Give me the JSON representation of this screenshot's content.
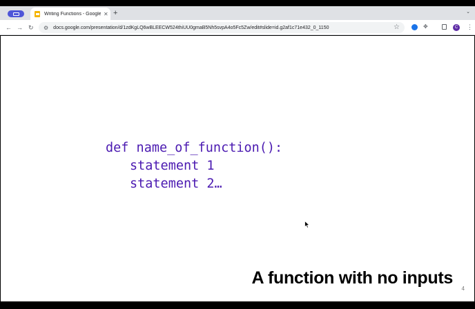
{
  "browser": {
    "tab": {
      "title": "Writing Functions - Google Slides",
      "close_glyph": "✕"
    },
    "new_tab_glyph": "+",
    "tab_search_glyph": "⌄",
    "nav": {
      "back": "←",
      "forward": "→",
      "reload": "↻"
    },
    "url": "docs.google.com/presentation/d/1zdKgLQ6wBLEECW524thiUU0gmaB5Nh5svpA4o5Fc5Zw/edit#slide=id.g2af1c71e432_0_1150",
    "profile_initial": "C",
    "colors": {
      "group_chip": "#4e55d8",
      "favicon": "#f4b400",
      "profile": "#5e2ca5"
    }
  },
  "slide": {
    "code_lines": [
      "def name_of_function():",
      "statement 1",
      "statement 2…"
    ],
    "title": "A function with no inputs",
    "page_number": "4",
    "colors": {
      "code": "#4b1ab1",
      "title": "#000000",
      "background": "#ffffff"
    }
  }
}
